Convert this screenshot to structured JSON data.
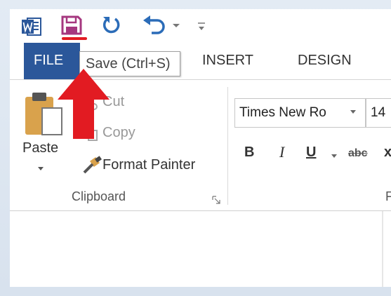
{
  "qat": {
    "word_icon": "word-app-icon",
    "save_icon": "save-floppy-icon",
    "repeat_icon": "repeat-icon",
    "undo_icon": "undo-icon",
    "customize_icon": "customize-qat-icon"
  },
  "tabs": {
    "file": "FILE",
    "insert": "INSERT",
    "design": "DESIGN"
  },
  "tooltip": {
    "text": "Save (Ctrl+S)"
  },
  "clipboard": {
    "paste": "Paste",
    "cut": "Cut",
    "copy": "Copy",
    "format_painter": "Format Painter",
    "group_label": "Clipboard"
  },
  "font": {
    "name": "Times New Ro",
    "size": "14",
    "bold": "B",
    "italic": "I",
    "underline": "U",
    "strikethrough": "abc",
    "subscript": "x",
    "group_label": "F"
  },
  "colors": {
    "file_tab": "#2b579a",
    "save_icon": "#a5377f",
    "accent_red": "#e21b22",
    "word_blue": "#2b579a"
  }
}
